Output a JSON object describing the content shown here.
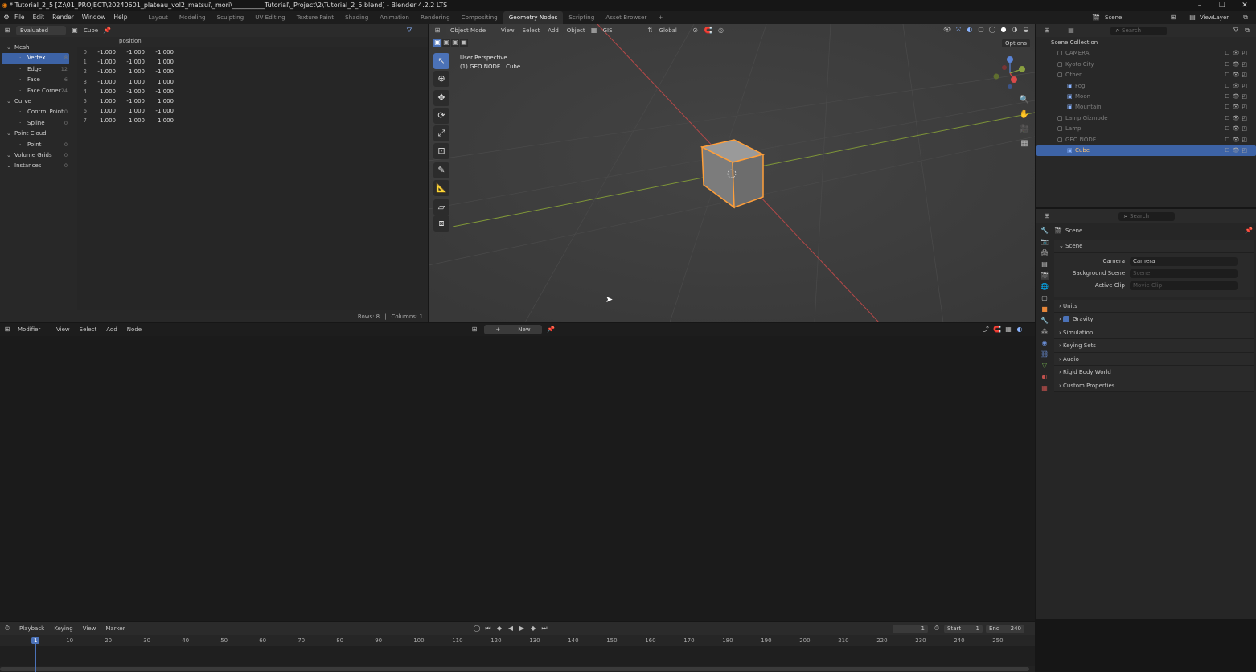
{
  "title_bar": {
    "title": "* Tutorial_2_5 [Z:\\01_PROJECT\\20240601_plateau_vol2_matsui\\_mori\\__________Tutorial\\_Project\\2\\Tutorial_2_5.blend] - Blender 4.2.2 LTS",
    "minimize": "–",
    "maximize": "❐",
    "close": "✕"
  },
  "menu": [
    "File",
    "Edit",
    "Render",
    "Window",
    "Help"
  ],
  "workspaces": [
    "Layout",
    "Modeling",
    "Sculpting",
    "UV Editing",
    "Texture Paint",
    "Shading",
    "Animation",
    "Rendering",
    "Compositing",
    "Geometry Nodes",
    "Scripting",
    "Asset Browser"
  ],
  "active_workspace": "Geometry Nodes",
  "add_tab": "+",
  "scene_selector": {
    "scene": "Scene",
    "view_layer": "ViewLayer"
  },
  "spreadsheet": {
    "mode": "Evaluated",
    "object": "Cube",
    "tree": [
      {
        "label": "Mesh",
        "level": 0,
        "count": ""
      },
      {
        "label": "Vertex",
        "level": 1,
        "count": "8",
        "selected": true
      },
      {
        "label": "Edge",
        "level": 1,
        "count": "12"
      },
      {
        "label": "Face",
        "level": 1,
        "count": "6"
      },
      {
        "label": "Face Corner",
        "level": 1,
        "count": "24"
      },
      {
        "label": "Curve",
        "level": 0,
        "count": ""
      },
      {
        "label": "Control Point",
        "level": 1,
        "count": "0"
      },
      {
        "label": "Spline",
        "level": 1,
        "count": "0"
      },
      {
        "label": "Point Cloud",
        "level": 0,
        "count": ""
      },
      {
        "label": "Point",
        "level": 1,
        "count": "0"
      },
      {
        "label": "Volume Grids",
        "level": 0,
        "count": "0"
      },
      {
        "label": "Instances",
        "level": 0,
        "count": "0"
      }
    ],
    "column_header": "position",
    "rows": [
      [
        "0",
        "-1.000",
        "-1.000",
        "-1.000"
      ],
      [
        "1",
        "-1.000",
        "-1.000",
        "1.000"
      ],
      [
        "2",
        "-1.000",
        "1.000",
        "-1.000"
      ],
      [
        "3",
        "-1.000",
        "1.000",
        "1.000"
      ],
      [
        "4",
        "1.000",
        "-1.000",
        "-1.000"
      ],
      [
        "5",
        "1.000",
        "-1.000",
        "1.000"
      ],
      [
        "6",
        "1.000",
        "1.000",
        "-1.000"
      ],
      [
        "7",
        "1.000",
        "1.000",
        "1.000"
      ]
    ],
    "footer_rows": "Rows: 8",
    "footer_cols": "Columns: 1"
  },
  "viewport": {
    "mode": "Object Mode",
    "menus": [
      "View",
      "Select",
      "Add",
      "Object"
    ],
    "gis": "GIS",
    "orientation": "Global",
    "overlay_title": "User Perspective",
    "overlay_sub": "(1) GEO NODE | Cube",
    "options": "Options",
    "search_placeholder": "Search"
  },
  "outliner": {
    "search_placeholder": "Search",
    "root": "Scene Collection",
    "items": [
      {
        "label": "CAMERA",
        "level": 1
      },
      {
        "label": "Kyoto City",
        "level": 1
      },
      {
        "label": "Other",
        "level": 1
      },
      {
        "label": "Fog",
        "level": 2
      },
      {
        "label": "Moon",
        "level": 2
      },
      {
        "label": "Mountain",
        "level": 2
      },
      {
        "label": "Lamp Gizmode",
        "level": 1
      },
      {
        "label": "Lamp",
        "level": 1
      },
      {
        "label": "GEO NODE",
        "level": 1
      },
      {
        "label": "Cube",
        "level": 2,
        "selected": true
      }
    ]
  },
  "properties": {
    "search_placeholder": "Search",
    "context": "Scene",
    "section": "Scene",
    "camera_label": "Camera",
    "camera_value": "Camera",
    "bg_label": "Background Scene",
    "bg_placeholder": "Scene",
    "clip_label": "Active Clip",
    "clip_placeholder": "Movie Clip",
    "panels": [
      "Units",
      "Gravity",
      "Simulation",
      "Keying Sets",
      "Audio",
      "Rigid Body World",
      "Custom Properties"
    ]
  },
  "node_editor": {
    "type": "Modifier",
    "menus": [
      "View",
      "Select",
      "Add",
      "Node"
    ],
    "new_label": "New"
  },
  "timeline": {
    "menus": [
      "Playback",
      "Keying",
      "View",
      "Marker"
    ],
    "current_frame": "1",
    "start_label": "Start",
    "start": "1",
    "end_label": "End",
    "end": "240",
    "ticks": [
      "1",
      "10",
      "20",
      "30",
      "40",
      "50",
      "60",
      "70",
      "80",
      "90",
      "100",
      "110",
      "120",
      "130",
      "140",
      "150",
      "160",
      "170",
      "180",
      "190",
      "200",
      "210",
      "220",
      "230",
      "240",
      "250"
    ]
  },
  "colors": {
    "accent": "#4b72b8",
    "selection": "#ff9f3a",
    "x_axis": "#c84545",
    "y_axis": "#8aa040"
  }
}
